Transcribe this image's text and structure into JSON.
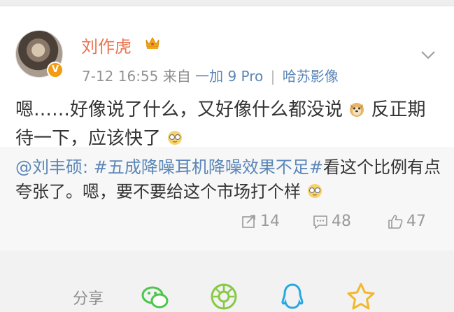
{
  "post": {
    "username": "刘作虎",
    "time": "7-12 16:55",
    "source_prefix": "来自",
    "device": "一加 9 Pro",
    "divider": "|",
    "app": "哈苏影像",
    "text_part1": "嗯……好像说了什么，又好像什么都没说",
    "text_part2": "反正期待一下，应该快了"
  },
  "repost": {
    "mention": "@刘丰硕",
    "colon": ":",
    "hashtag": "#五成降噪耳机降噪效果不足#",
    "text": "看这个比例有点夸张了。嗯，要不要给这个市场打个样"
  },
  "actions": {
    "reposts": "14",
    "comments": "48",
    "likes": "47"
  },
  "share": {
    "label": "分享"
  },
  "colors": {
    "username": "#eb7350",
    "link": "#5b86b7",
    "text": "#333333",
    "wechat": "#4cc54c",
    "moments": "#86c943",
    "qq": "#29a7e2",
    "favorite": "#f2b82e"
  },
  "icons": {
    "crown": "vip-crown-icon",
    "verified": "verified-badge-icon",
    "doge": "doge-emoji-icon",
    "glasses": "glasses-emoji-icon",
    "repost": "repost-icon",
    "comment": "comment-icon",
    "like": "like-icon"
  }
}
